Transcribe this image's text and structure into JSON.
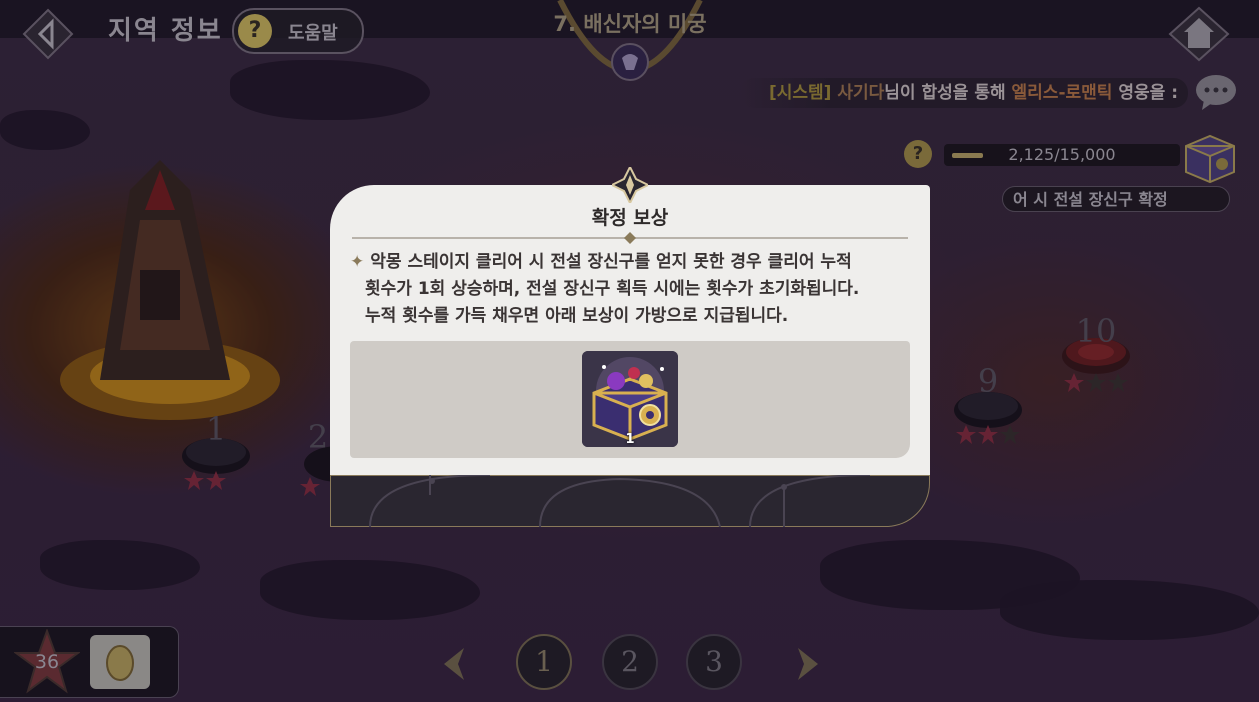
{
  "header": {
    "title": "지역 정보",
    "help_icon": "?",
    "help_label": "도움말",
    "stage_title": "7. 배신자의 미궁"
  },
  "ticker": {
    "prefix": "[시스템]",
    "player": "사기다",
    "middle1": "님이 합성을 통해 ",
    "hero": "엘리스-로맨틱",
    "middle2": " 영웅을 :"
  },
  "progress": {
    "help_icon": "?",
    "current": 2125,
    "max": 15000,
    "text": "2,125/15,000"
  },
  "confirm_note": "어 시 전설 장신구 확정",
  "map_nodes": [
    {
      "label": "1"
    },
    {
      "label": "2"
    },
    {
      "label": "9"
    },
    {
      "label": "10"
    }
  ],
  "bottom": {
    "star_count": "36"
  },
  "pager": {
    "pages": [
      "1",
      "2",
      "3"
    ],
    "active_page": "1"
  },
  "modal": {
    "title": "확정 보상",
    "bullet": "✦",
    "text_line1": "악몽 스테이지 클리어 시 전설 장신구를 얻지 못한 경우 클리어 누적",
    "text_line2": "횟수가 1회 상승하며, 전설 장신구 획득 시에는 횟수가 초기화됩니다.",
    "text_line3": "누적 횟수를 가득 채우면 아래 보상이 가방으로 지급됩니다.",
    "reward": {
      "icon": "legendary-accessory-chest-icon",
      "quantity": "1"
    }
  },
  "colors": {
    "modal_bg": "#efeeec",
    "reward_panel": "#cfcbc6",
    "footer": "#2a2630",
    "ticker_system": "#7a6a30"
  }
}
